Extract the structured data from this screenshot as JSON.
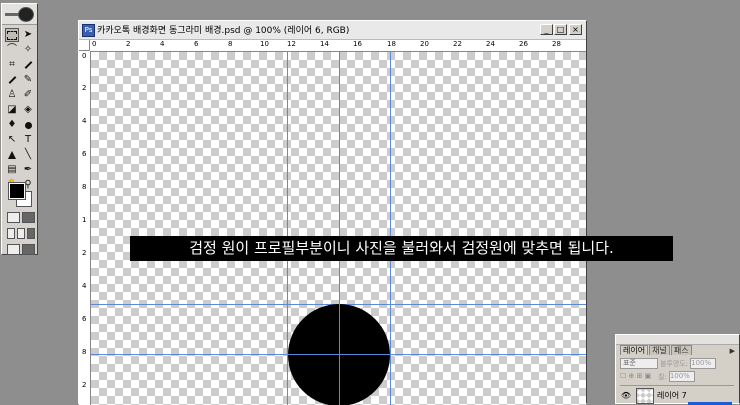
{
  "document": {
    "title": "카카오톡 배경화면 동그라미 배경.psd @ 100% (레이어 6, RGB)",
    "ruler_top_labels": [
      "0",
      "2",
      "4",
      "6",
      "8",
      "10",
      "12",
      "14",
      "16",
      "18",
      "20",
      "22",
      "24",
      "26",
      "28"
    ],
    "ruler_left_labels": [
      "0",
      "2",
      "4",
      "6",
      "8",
      "1",
      "2",
      "4",
      "6",
      "8",
      "2"
    ],
    "window_buttons": [
      "_",
      "□",
      "×"
    ]
  },
  "caption": "검정 원이 프로필부분이니 사진을 불러와서 검정원에 맞추면 됩니다.",
  "layers_panel": {
    "tabs": [
      "레이어",
      "채널",
      "패스"
    ],
    "blend_mode": "표준",
    "opacity_label": "불투명도:",
    "opacity_value": "100%",
    "fill_label": "칠:",
    "fill_value": "100%",
    "layer_name": "레이어 7"
  },
  "colors": {
    "foreground": "#000000",
    "background": "#ffffff",
    "guide": "#5b8bd8"
  }
}
